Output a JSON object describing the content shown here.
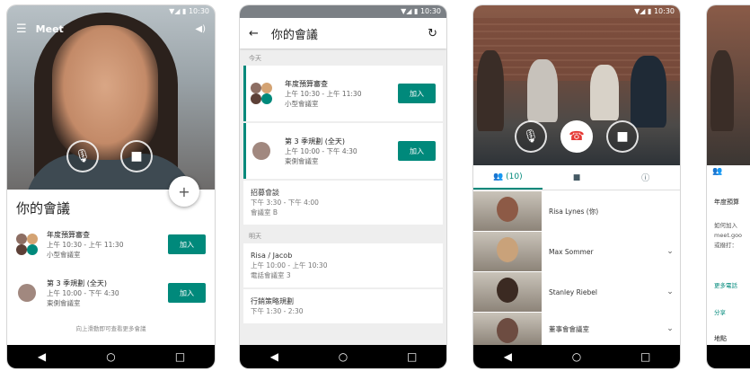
{
  "status": {
    "time": "10:30",
    "signal": "▼◢ ▮"
  },
  "screen1": {
    "app_name": "Meet",
    "sheet_title": "你的會議",
    "meetings": [
      {
        "title": "年度預算審查",
        "time": "上午 10:30 - 上午 11:30",
        "room": "小型會議室",
        "join": "加入"
      },
      {
        "title": "第 3 季規劃 (全天)",
        "time": "上午 10:00 - 下午 4:30",
        "room": "東側會議室",
        "join": "加入"
      }
    ],
    "footer": "向上滑動即可查看更多會議"
  },
  "screen2": {
    "title": "你的會議",
    "section_today": "今天",
    "section_tomorrow": "明天",
    "cards": [
      {
        "title": "年度預算審查",
        "time": "上午 10:30 - 上午 11:30",
        "room": "小型會議室",
        "join": "加入"
      },
      {
        "title": "第 3 季規劃 (全天)",
        "time": "上午 10:00 - 下午 4:30",
        "room": "東側會議室",
        "join": "加入"
      }
    ],
    "plain_today": {
      "title": "招募會談",
      "time": "下午 3:30 - 下午 4:00",
      "room": "會議室 B"
    },
    "tomorrow": [
      {
        "title": "Risa / Jacob",
        "time": "上午 10:00 - 上午 10:30",
        "room": "電話會議室 3"
      },
      {
        "title": "行銷策略規劃",
        "time": "下午 1:30 - 2:30",
        "room": ""
      }
    ]
  },
  "screen3": {
    "tab_people": "(10)",
    "participants": [
      {
        "name": "Risa Lynes (你)"
      },
      {
        "name": "Max Sommer"
      },
      {
        "name": "Stanley Riebel"
      },
      {
        "name": "董事會會議室"
      }
    ]
  },
  "screen4": {
    "title_partial": "年度預算",
    "lines": [
      "如何加入",
      "meet.goo",
      "或撥打：",
      "更多電話",
      "分享",
      "地點"
    ]
  },
  "colors": {
    "accent": "#00897b",
    "hangup": "#e53935"
  }
}
